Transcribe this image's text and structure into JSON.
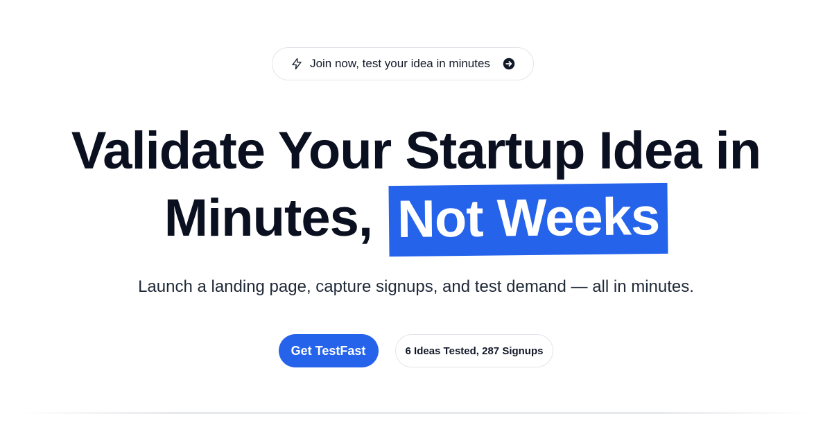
{
  "announcement": {
    "text": "Join now, test your idea in minutes",
    "leading_icon": "lightning-bolt-icon",
    "trailing_icon": "arrow-right-circle-icon"
  },
  "headline": {
    "line1": "Validate Your Startup Idea in",
    "line2_plain": "Minutes,",
    "line2_highlight": "Not Weeks"
  },
  "subtitle": "Launch a landing page, capture signups, and test demand — all in minutes.",
  "cta": {
    "primary_label": "Get TestFast",
    "stats_label": "6 Ideas Tested, 287 Signups"
  },
  "colors": {
    "accent": "#2563eb",
    "text": "#0b1020",
    "border": "#e2e5ea"
  }
}
